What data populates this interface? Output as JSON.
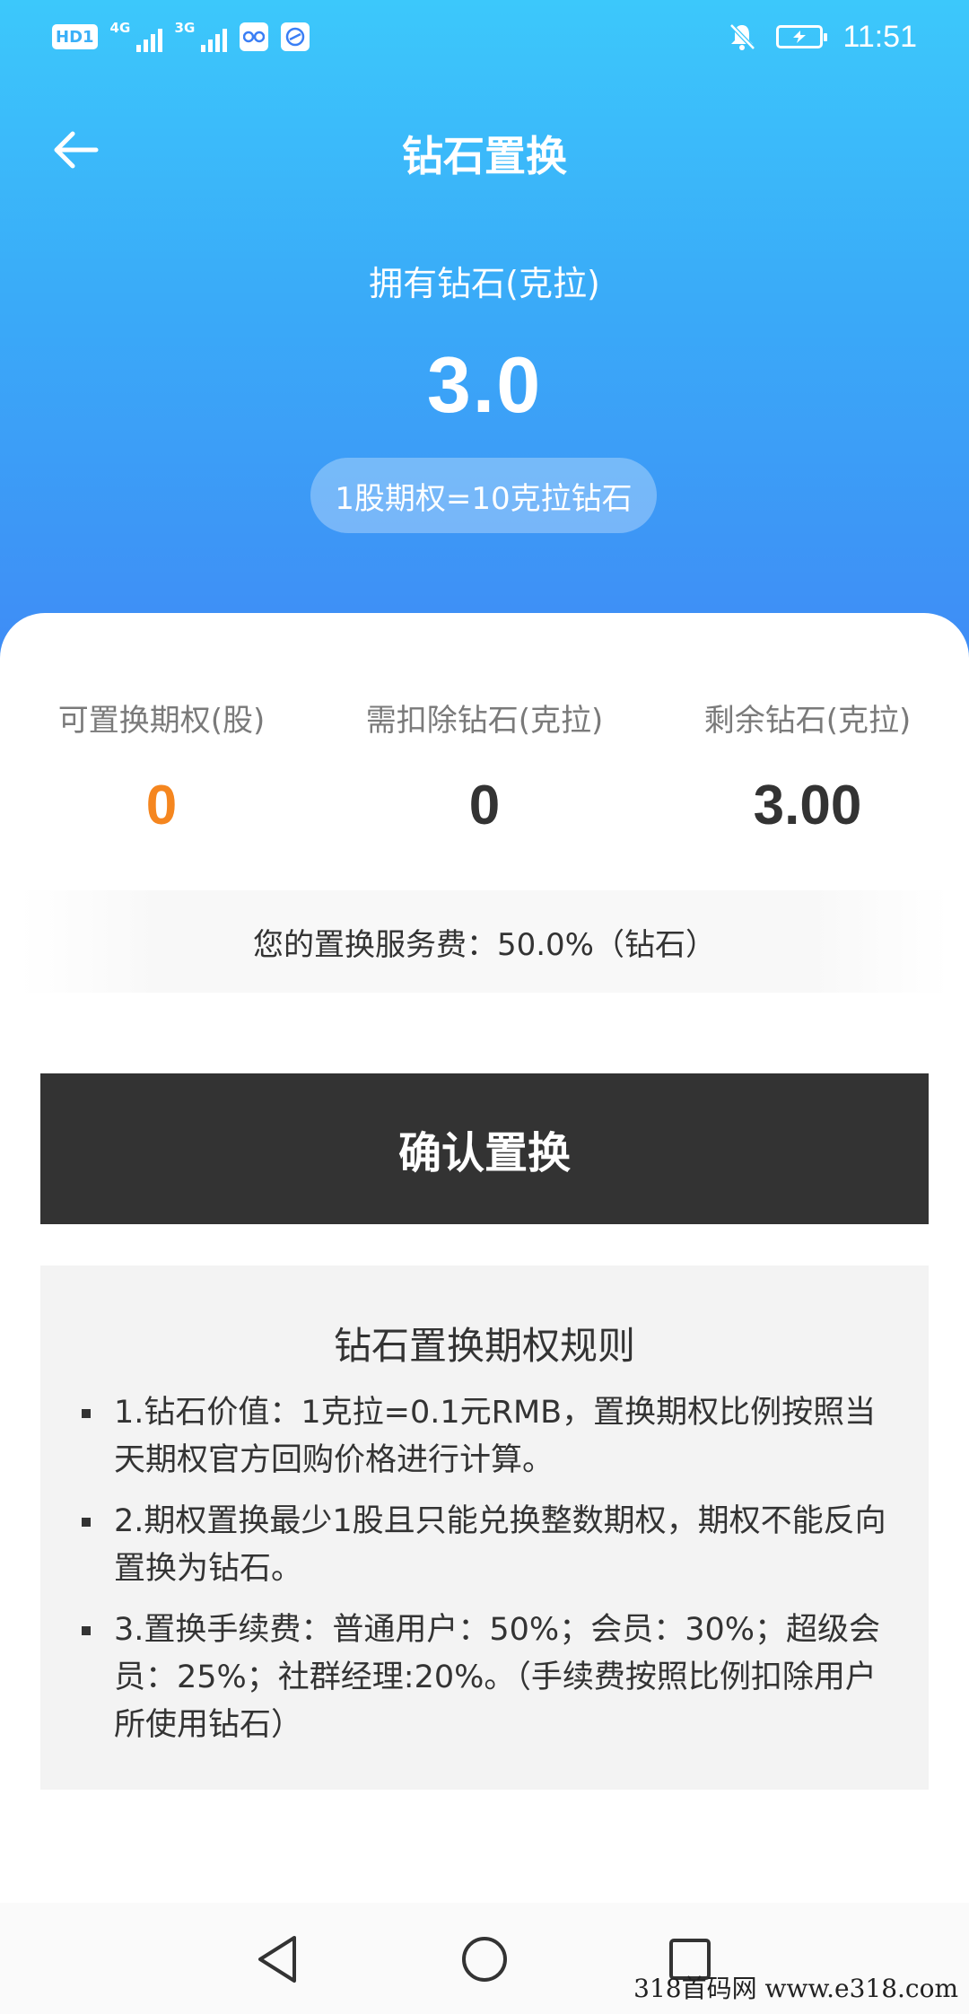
{
  "status_bar": {
    "badge": "HD1",
    "network1": "4G",
    "network2": "3G",
    "time": "11:51",
    "icons": [
      "hd-icon",
      "signal-icon",
      "signal-icon",
      "app-icon",
      "browser-icon",
      "bell-muted-icon",
      "battery-charging-icon"
    ]
  },
  "header": {
    "title": "钻石置换",
    "back_icon": "arrow-left-icon",
    "owned_label": "拥有钻石(克拉)",
    "owned_value": "3.0",
    "ratio_text": "1股期权=10克拉钻石"
  },
  "stats": [
    {
      "label": "可置换期权(股)",
      "value": "0",
      "color": "#f5861f"
    },
    {
      "label": "需扣除钻石(克拉)",
      "value": "0",
      "color": "#333333"
    },
    {
      "label": "剩余钻石(克拉)",
      "value": "3.00",
      "color": "#333333"
    }
  ],
  "fee_text": "您的置换服务费：50.0%（钻石）",
  "confirm_label": "确认置换",
  "rules": {
    "title": "钻石置换期权规则",
    "items": [
      "1.钻石价值：1克拉=0.1元RMB，置换期权比例按照当天期权官方回购价格进行计算。",
      "2.期权置换最少1股且只能兑换整数期权，期权不能反向置换为钻石。",
      "3.置换手续费：普通用户：50%；会员：30%；超级会员：25%；社群经理:20%。（手续费按照比例扣除用户所使用钻石）"
    ]
  },
  "nav": {
    "back": "nav-back-icon",
    "home": "nav-home-icon",
    "recents": "nav-recents-icon"
  },
  "watermark": "318首码网 www.e318.com",
  "colors": {
    "gradient_top": "#3cc8fb",
    "gradient_bottom": "#3f8af5",
    "accent_orange": "#f5861f",
    "button_dark": "#333333"
  }
}
